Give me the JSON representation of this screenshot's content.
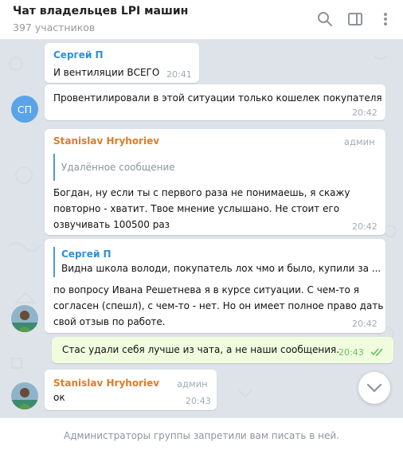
{
  "header": {
    "title": "Чат владельцев LPI машин",
    "subtitle": "397 участников"
  },
  "messages": [
    {
      "author": "Сергей П",
      "text": "И вентиляции ВСЕГО",
      "time": "20:41"
    },
    {
      "avatar_initials": "СП",
      "text": "Провентилировали в этой ситуации только кошелек покупателя",
      "time": "20:42"
    },
    {
      "author": "Stanislav Hryhoriev",
      "role": "админ",
      "reply_text": "Удалённое сообщение",
      "lines": [
        "Богдан, ну если ты с первого раза не понимаешь, я скажу",
        "повторно - хватит. Твое мнение услышано. Не стоит его",
        "озвучивать 100500 раз"
      ],
      "time": "20:42"
    },
    {
      "reply_author": "Сергей П",
      "reply_text": "Видна школа володи, покупатель лох чмо и было, купили за ...",
      "lines": [
        "по вопросу Ивана Решетнева я в курсе ситуации. С чем-то я",
        "согласен (спешл), с чем-то - нет. Но он имеет полное право дать",
        "свой отзыв по работе."
      ],
      "time": "20:42"
    },
    {
      "text": "Стас удали себя лучше из чата, а не наши сообщения.",
      "time": "20:43"
    },
    {
      "author": "Stanislav Hryhoriev",
      "role": "админ",
      "text": "ок",
      "time": "20:43"
    }
  ],
  "footer": {
    "notice": "Администраторы группы запретили вам писать в ней."
  },
  "colors": {
    "author_blue": "#2e8fd9",
    "author_orange": "#e07b26",
    "outgoing": "#effdde",
    "check": "#6cbf5f"
  },
  "icons": [
    "search-icon",
    "sidebar-toggle-icon",
    "more-vertical-icon",
    "double-check-icon",
    "chevron-down-icon"
  ]
}
